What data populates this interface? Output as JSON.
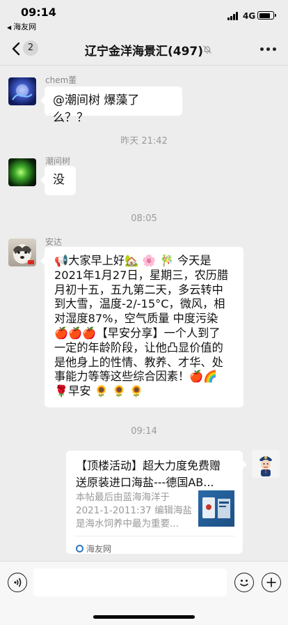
{
  "status_bar": {
    "time": "09:14",
    "back_label": "海友网",
    "network": "4G",
    "battery_level": 0.85
  },
  "navbar": {
    "unread_count": "2",
    "title": "辽宁金洋海景汇(497)"
  },
  "messages": [
    {
      "sender": "chem董",
      "text": "@潮间树 爆藻了么？？"
    },
    {
      "timestamp": "昨天 21:42"
    },
    {
      "sender": "潮间树",
      "text": "没"
    },
    {
      "timestamp": "08:05"
    },
    {
      "sender": "安达",
      "lines": [
        "📢大家早上好🏡 🌸 🎋 今天是",
        "2021年1月27日，星期三，农历腊",
        "月初十五，五九第二天，多云转中",
        "到大雪，温度-2/-15°C，微风，相",
        "对湿度87%，空气质量 中度污染",
        "🍎🍎🍎【早安分享】一个人到了",
        "一定的年龄阶段，让他凸显价值的",
        "是他身上的性情、教养、才华、处",
        "事能力等等这些综合因素！🍎🌈",
        "🌹早安  🌻 🌻 🌻"
      ]
    },
    {
      "timestamp": "09:14"
    },
    {
      "card": {
        "title": "【顶楼活动】超大力度免费赠送原装进口海盐---德国AB...",
        "title_line1": "【顶楼活动】超大力度免费赠",
        "title_line2": "送原装进口海盐---德国AB...",
        "desc_line1": "本帖最后由蓝海海洋于",
        "desc_line2": "2021-1-2011:37 编辑海盐",
        "desc_line3": "是海水饲养中最为重要...",
        "source": "海友网"
      }
    }
  ]
}
